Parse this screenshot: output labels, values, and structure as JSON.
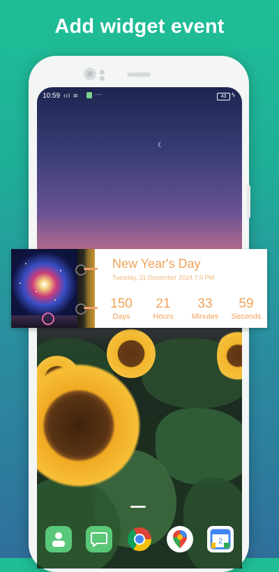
{
  "headline": "Add widget event",
  "status_bar": {
    "time": "10:59",
    "signal_icons": "ııl ≋",
    "more": "···",
    "battery": "43",
    "charging": "ϟ"
  },
  "widget": {
    "title": "New Year's Day",
    "date": "Tuesday, 31  December  2024  7:0 PM",
    "countdown": [
      {
        "value": "150",
        "label": "Days"
      },
      {
        "value": "21",
        "label": "Hours"
      },
      {
        "value": "33",
        "label": "Minutes"
      },
      {
        "value": "59",
        "label": "Seconds"
      }
    ]
  },
  "dock": {
    "calendar_day": "2"
  },
  "icons": [
    "contacts-icon",
    "messages-icon",
    "chrome-icon",
    "maps-icon",
    "calendar-icon",
    "moon-icon"
  ],
  "colors": {
    "background_top": "#1fbf96",
    "background_bottom": "#2f6f9b",
    "accent": "#f0a35a"
  }
}
